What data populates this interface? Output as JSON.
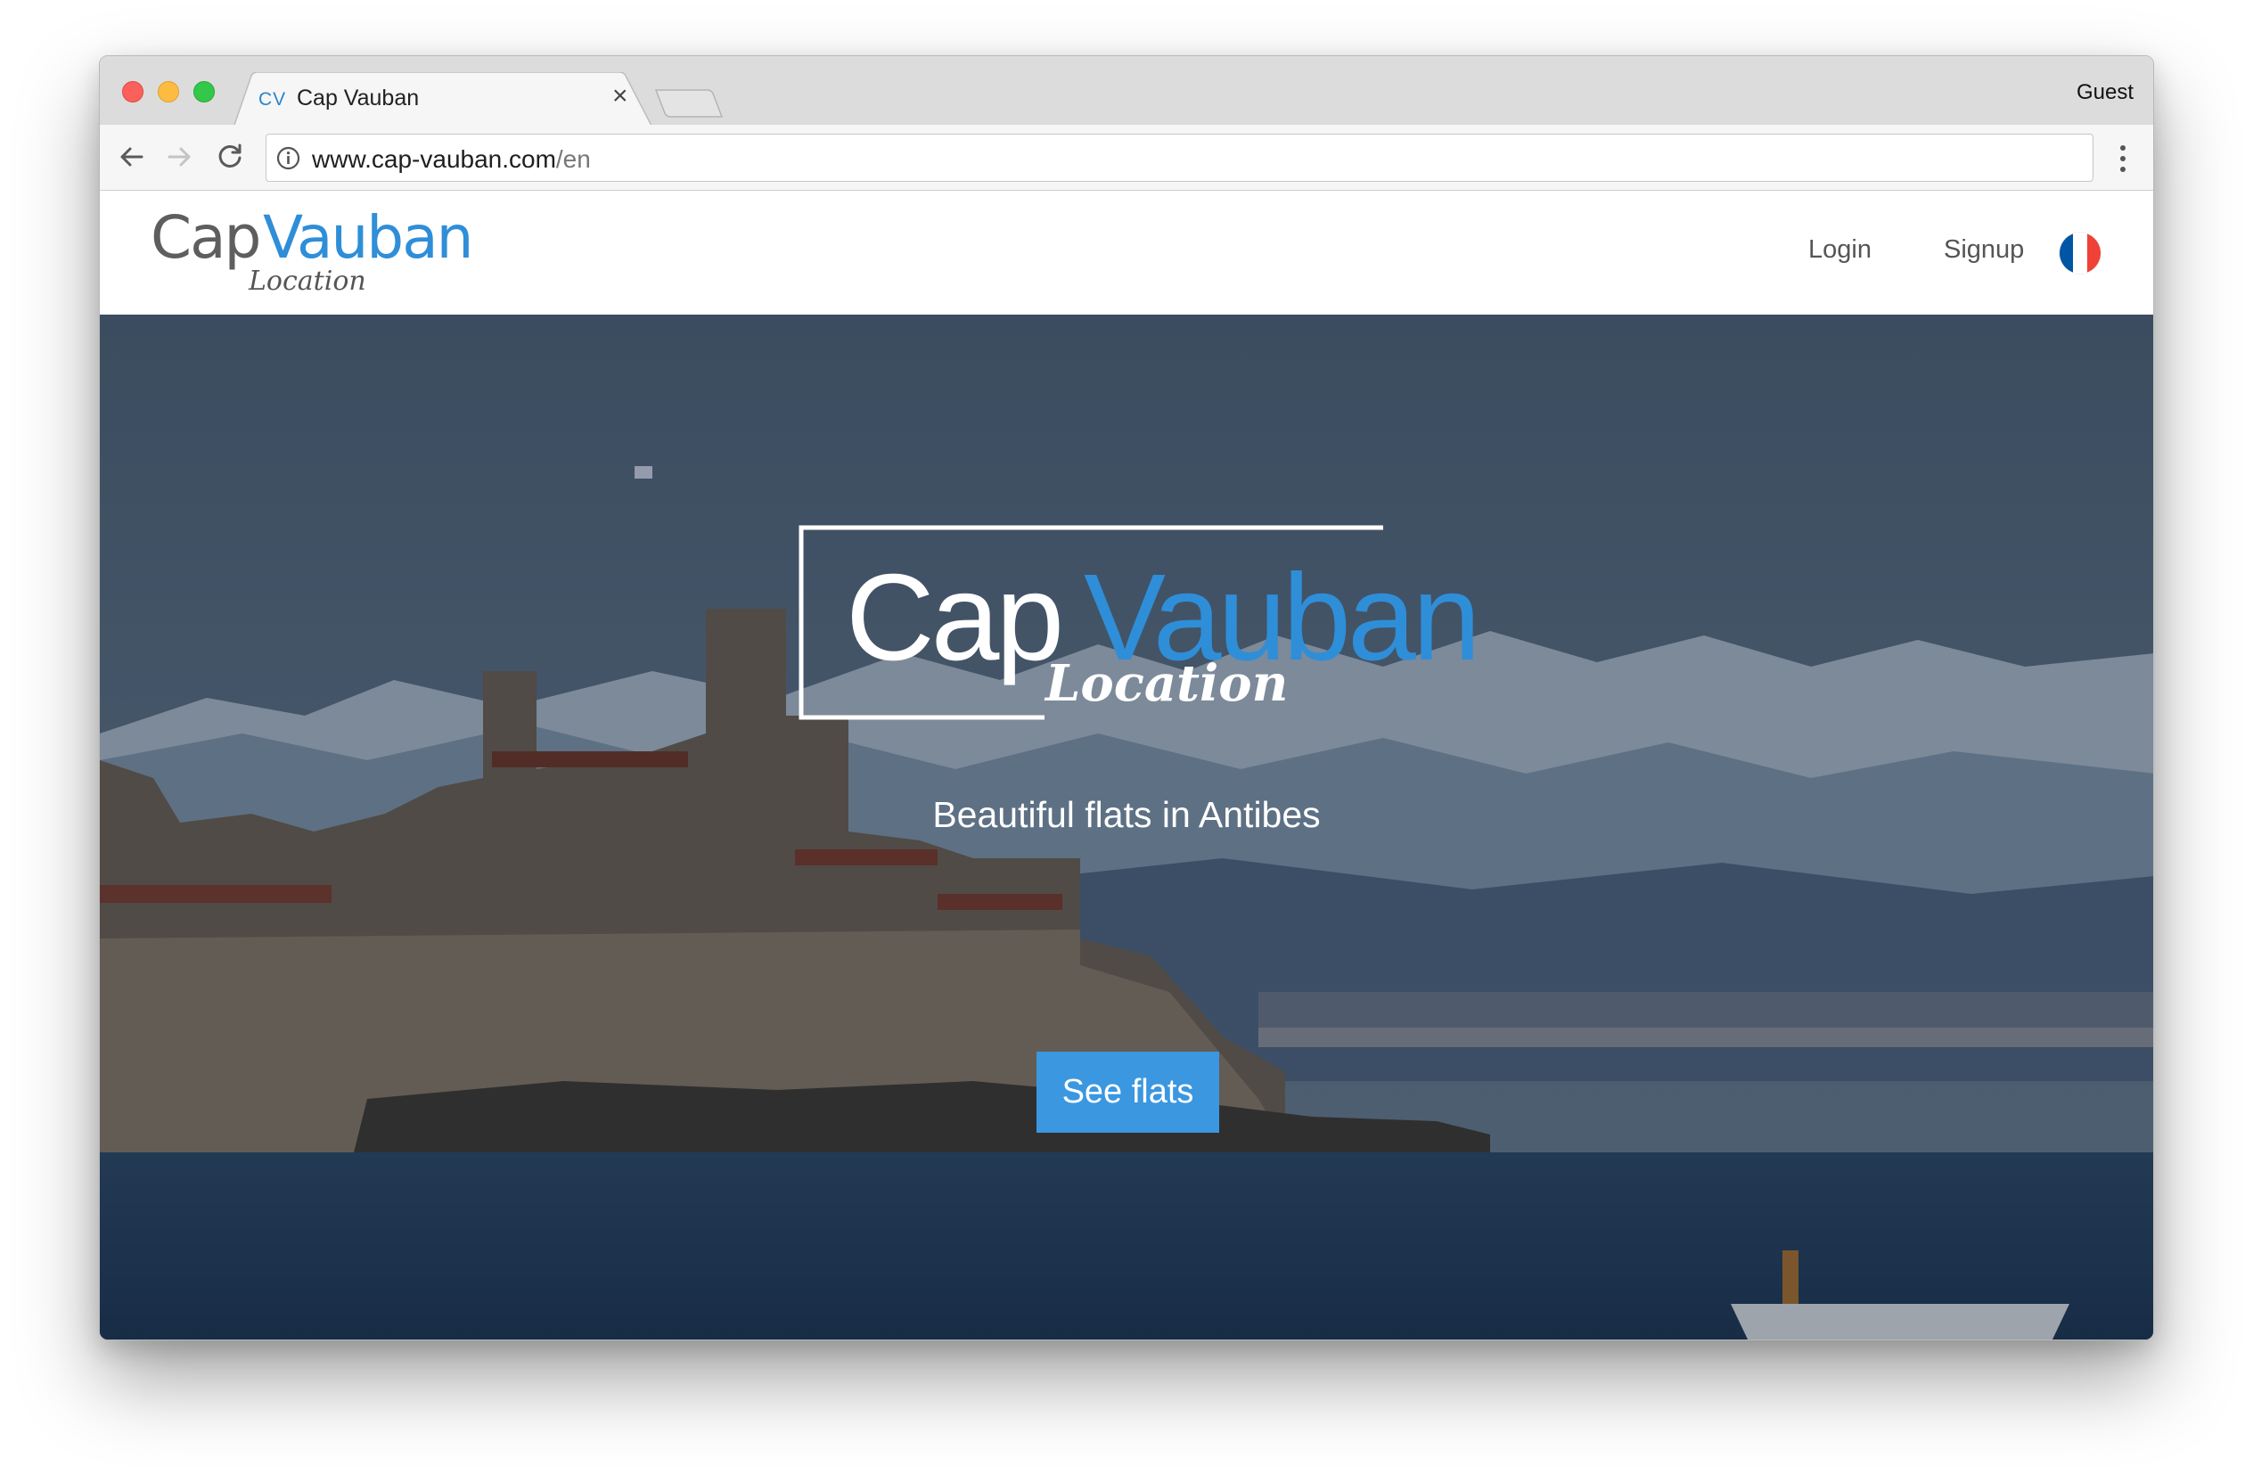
{
  "browser": {
    "tab": {
      "favicon_text": "CV",
      "title": "Cap Vauban",
      "close_glyph": "×"
    },
    "profile_label": "Guest",
    "address": {
      "host": "www.cap-vauban.com",
      "path": "/en"
    }
  },
  "site": {
    "logo": {
      "cap": "Cap",
      "vauban": "Vauban",
      "location": "Location"
    },
    "nav": {
      "login": "Login",
      "signup": "Signup"
    },
    "flag": {
      "colors": [
        "#0055a4",
        "#ffffff",
        "#ef4135"
      ]
    },
    "hero": {
      "logo": {
        "cap": "Cap",
        "vauban": "Vauban",
        "location": "Location"
      },
      "tagline": "Beautiful flats in Antibes",
      "cta": "See flats"
    },
    "accent_color": "#2f8ed8"
  }
}
